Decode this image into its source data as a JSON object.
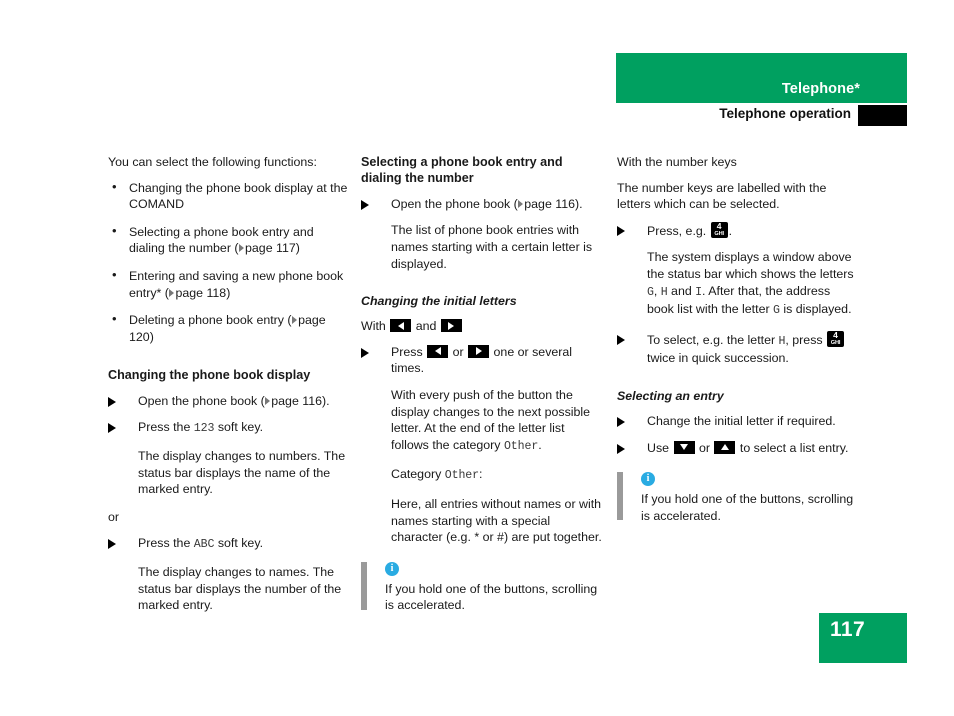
{
  "header": {
    "title": "Telephone*",
    "subtitle": "Telephone operation"
  },
  "footer": {
    "page_number": "117"
  },
  "colors": {
    "brand_green": "#00A060",
    "note_blue": "#29ABE2",
    "note_bar_gray": "#9a9a9a"
  },
  "column_left": {
    "intro": "You can select the following functions:",
    "bullets": [
      {
        "text_a": "Changing the phone book display at the COMAND"
      },
      {
        "text_a": "Selecting a phone book entry and dialing the number (",
        "page": "page 117",
        "text_b": ")"
      },
      {
        "text_a": "Entering and saving a new phone book entry* (",
        "page": "page 118",
        "text_b": ")"
      },
      {
        "text_a": "Deleting a phone book entry (",
        "page": "page 120",
        "text_b": ")"
      }
    ],
    "section_title": "Changing the phone book display",
    "step1_a": "Open the phone book (",
    "step1_page": "page 116",
    "step1_b": ").",
    "step2_a": "Press the ",
    "step2_key": "123",
    "step2_b": " soft key.",
    "result1": "The display changes to numbers. The status bar displays the name of the marked entry.",
    "or_label": "or",
    "step3_a": "Press the ",
    "step3_key": "ABC",
    "step3_b": " soft key.",
    "result2": "The display changes to names. The status bar displays the number of the marked entry."
  },
  "column_middle": {
    "section_title": "Selecting a phone book entry and dialing the number",
    "step1_a": "Open the phone book (",
    "step1_page": "page 116",
    "step1_b": ").",
    "result1": "The list of phone book entries with names starting with a certain letter is displayed.",
    "sub_title": "Changing the initial letters",
    "with_label": "With",
    "with_and": "and",
    "press_label": "Press",
    "press_or": "or",
    "press_tail": "one or several times.",
    "result2_a": "With every push of the button the display changes to the next possible letter. At the end of the letter list follows the category ",
    "result2_key": "Other",
    "result2_b": ".",
    "category_a": "Category ",
    "category_key": "Other",
    "category_b": ":",
    "result3": "Here, all entries without names or with names starting with a special character (e.g. * or #) are put together.",
    "note": "If you hold one of the buttons, scrolling is accelerated."
  },
  "column_right": {
    "heading": "With the number keys",
    "intro": "The number keys are labelled with the letters which can be selected.",
    "step1_a": "Press, e.g. ",
    "step1_key_digit": "4",
    "step1_key_letters": "GHI",
    "step1_b": ".",
    "result1_a": "The system displays a window above the status bar which shows the letters ",
    "result1_k1": "G",
    "result1_sep1": ", ",
    "result1_k2": "H",
    "result1_sep2": " and ",
    "result1_k3": "I",
    "result1_mid": ". After that, the address book list with the letter ",
    "result1_k4": "G",
    "result1_end": " is displayed.",
    "step2_a": "To select, e.g. the letter ",
    "step2_key": "H",
    "step2_b": ", press ",
    "step2_key_digit": "4",
    "step2_key_letters": "GHI",
    "step2_c": "twice in quick succession.",
    "sub_title": "Selecting an entry",
    "step3": "Change the initial letter if required.",
    "step4_a": "Use",
    "step4_or": "or",
    "step4_b": "to select a list entry.",
    "note": "If you hold one of the buttons, scrolling is accelerated."
  }
}
